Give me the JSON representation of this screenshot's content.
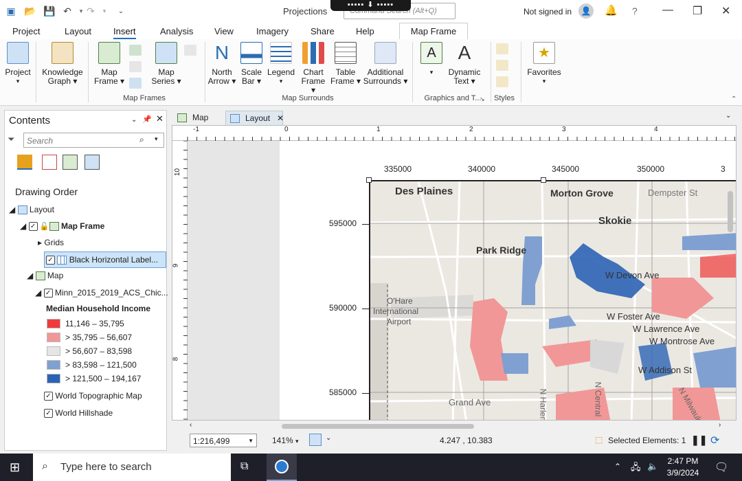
{
  "app": {
    "title": "Projections",
    "command_search_placeholder": "Command Search (Alt+Q)",
    "signin": "Not signed in"
  },
  "tabs": [
    "Project",
    "Layout",
    "Insert",
    "Analysis",
    "View",
    "Imagery",
    "Share",
    "Help"
  ],
  "active_tab": "Insert",
  "contextual_tab": "Map Frame",
  "ribbon": {
    "project": {
      "label1": "Project"
    },
    "knowledge": {
      "label1": "Knowledge",
      "label2": "Graph"
    },
    "mapframe": {
      "label1": "Map",
      "label2": "Frame"
    },
    "mapseries": {
      "label1": "Map",
      "label2": "Series"
    },
    "northarrow": {
      "label1": "North",
      "label2": "Arrow"
    },
    "scalebar": {
      "label1": "Scale",
      "label2": "Bar"
    },
    "legend": {
      "label1": "Legend"
    },
    "chartframe": {
      "label1": "Chart",
      "label2": "Frame"
    },
    "tableframe": {
      "label1": "Table",
      "label2": "Frame"
    },
    "additional": {
      "label1": "Additional",
      "label2": "Surrounds"
    },
    "dynamictext": {
      "label1": "Dynamic",
      "label2": "Text"
    },
    "favorites": {
      "label1": "Favorites"
    },
    "groups": {
      "map_frames": "Map Frames",
      "map_surrounds": "Map Surrounds",
      "graphics": "Graphics and T...",
      "styles": "Styles"
    }
  },
  "contents": {
    "title": "Contents",
    "search_placeholder": "Search",
    "drawing_order": "Drawing Order",
    "items": {
      "layout": "Layout",
      "map_frame": "Map Frame",
      "grids": "Grids",
      "grid_item": "Black Horizontal Label...",
      "map": "Map",
      "layer": "Minn_2015_2019_ACS_Chic...",
      "legend_title": "Median Household Income",
      "topo": "World Topographic Map",
      "hillshade": "World Hillshade"
    },
    "classes": [
      {
        "label": "11,146 – 35,795",
        "color": "#ef3b3b"
      },
      {
        "label": "> 35,795 – 56,607",
        "color": "#f19797"
      },
      {
        "label": "> 56,607 – 83,598",
        "color": "#e5e5e5"
      },
      {
        "label": "> 83,598 – 121,500",
        "color": "#7fa0d1"
      },
      {
        "label": "> 121,500 – 194,167",
        "color": "#2c63b5"
      }
    ]
  },
  "doc_tabs": {
    "map": "Map",
    "layout": "Layout"
  },
  "ruler": {
    "h": [
      "-1",
      "0",
      "1",
      "2",
      "3",
      "4"
    ],
    "v": [
      "10",
      "9",
      "8"
    ]
  },
  "map": {
    "x_labels": [
      "335000",
      "340000",
      "345000",
      "350000",
      "3"
    ],
    "y_labels": [
      "595000",
      "590000",
      "585000"
    ],
    "places": {
      "des_plaines": "Des Plaines",
      "morton_grove": "Morton Grove",
      "dempster": "Dempster St",
      "skokie": "Skokie",
      "park_ridge": "Park Ridge",
      "devon": "W Devon Ave",
      "ohare1": "O'Hare",
      "ohare2": "International",
      "ohare3": "Airport",
      "foster": "W Foster Ave",
      "lawrence": "W Lawrence Ave",
      "montrose": "W Montrose Ave",
      "addison": "W Addison St",
      "grand": "Grand Ave",
      "harlem": "N Harlem",
      "central": "N Central",
      "milwaukee": "N Milwauk"
    }
  },
  "status": {
    "scale": "1:216,499",
    "zoom": "141%",
    "coords": "4.247 , 10.383",
    "selected": "Selected Elements: 1"
  },
  "taskbar": {
    "search": "Type here to search",
    "time": "2:47 PM",
    "date": "3/9/2024"
  }
}
